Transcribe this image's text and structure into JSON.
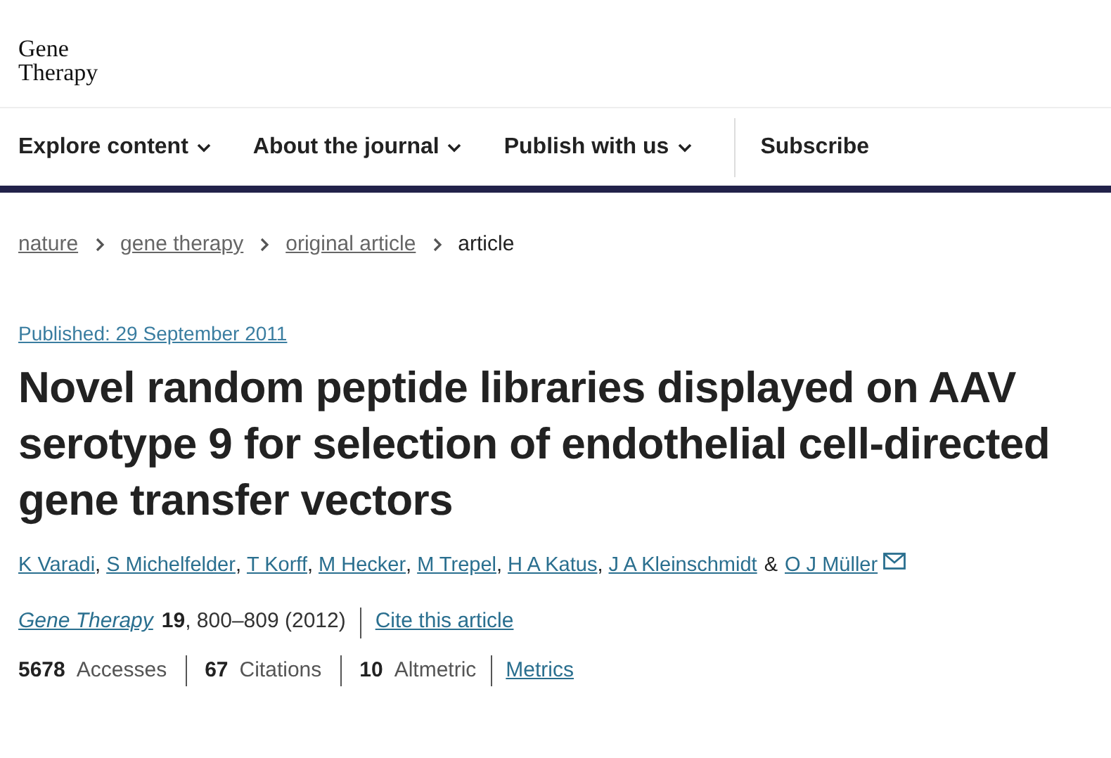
{
  "logo": [
    "Gene",
    "Therapy"
  ],
  "nav": [
    {
      "label": "Explore content",
      "dropdown": true
    },
    {
      "label": "About the journal",
      "dropdown": true
    },
    {
      "label": "Publish with us",
      "dropdown": true
    },
    {
      "label": "Subscribe",
      "dropdown": false
    }
  ],
  "breadcrumbs": [
    {
      "label": "nature",
      "link": true
    },
    {
      "label": "gene therapy",
      "link": true
    },
    {
      "label": "original article",
      "link": true
    },
    {
      "label": "article",
      "link": false
    }
  ],
  "published": "Published: 29 September 2011",
  "title": "Novel random peptide libraries displayed on AAV serotype 9 for selection of endothelial cell-directed gene transfer vectors",
  "authors": [
    "K Varadi",
    "S Michelfelder",
    "T Korff",
    "M Hecker",
    "M Trepel",
    "H A Katus",
    "J A Kleinschmidt",
    "O J Müller"
  ],
  "author_separator": ",",
  "last_separator": "&",
  "citation": {
    "journal": "Gene Therapy",
    "volume": "19",
    "pages": ", 800–809 (2012)",
    "cite_link": "Cite this article"
  },
  "metrics": [
    {
      "count": "5678",
      "name": "Accesses"
    },
    {
      "count": "67",
      "name": "Citations"
    },
    {
      "count": "10",
      "name": "Altmetric"
    }
  ],
  "metrics_link": "Metrics"
}
